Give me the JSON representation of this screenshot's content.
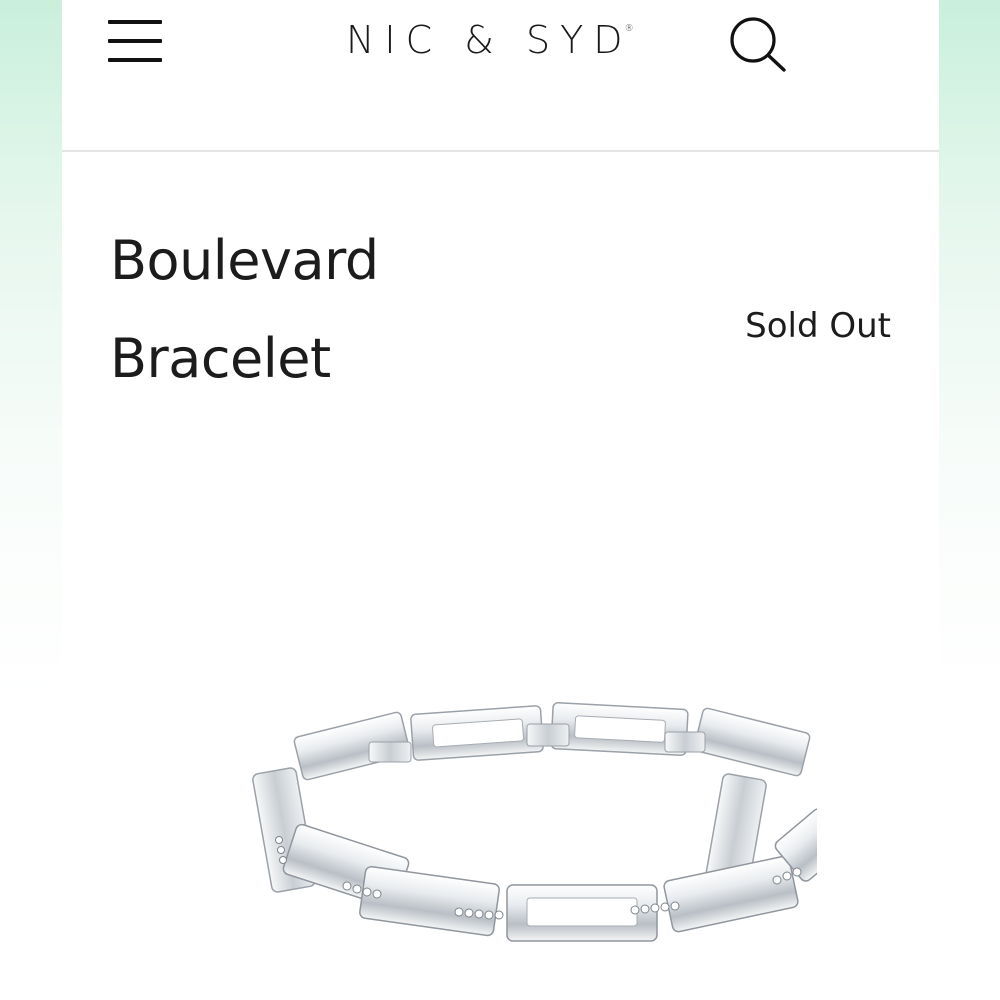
{
  "header": {
    "menu_icon": "hamburger-menu-icon",
    "logo_text": "NIC & SYD",
    "logo_mark": "®",
    "search_icon": "search-icon"
  },
  "product": {
    "title_line1": "Boulevard",
    "title_line2": "Bracelet",
    "status": "Sold Out",
    "image": "silver-link-bracelet-image"
  },
  "colors": {
    "text": "#1c1c1c",
    "background": "#ffffff",
    "side_gradient": "#c9f0dc",
    "divider": "#e4e4e4"
  }
}
